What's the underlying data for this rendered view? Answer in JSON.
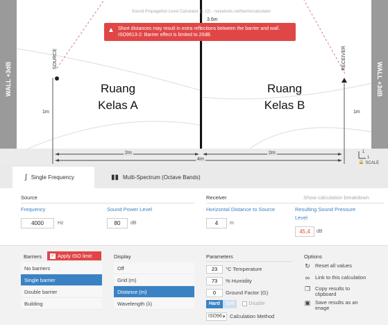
{
  "diagram": {
    "app_title": "Sound Propagation Level Calculator (1.12) - noisetools.net/barriercalculator",
    "warning_lines": [
      "Short distances may result in extra reflections between the barrier and wall.",
      "ISO9613-2: Barrier effect is limited to 20dB."
    ],
    "wall_left_label": "WALL +3dB",
    "wall_right_label": "WALL +3dB",
    "source_label": "SOURCE",
    "receiver_label": "RECEIVER",
    "barrier_height_label": "3.6m",
    "source_height_label": "1m",
    "receiver_height_label": "1m",
    "room_a_lines": [
      "Ruang",
      "Kelas A"
    ],
    "room_b_lines": [
      "Ruang",
      "Kelas B"
    ],
    "dist_left": "2m",
    "dist_right": "2m",
    "dist_total": "4m",
    "scale_top": "1",
    "scale_bottom": "1",
    "scale_label": "SCALE",
    "colors": {
      "wall": "#9a9a9a",
      "warning": "#e04646",
      "barrier": "#111111",
      "dashed_rays": "#e07a7a"
    }
  },
  "tabs": [
    {
      "label": "Single Frequency",
      "icon": "single-frequency-icon",
      "active": true
    },
    {
      "label": "Multi-Spectrum (Octave Bands)",
      "icon": "bar-chart-icon",
      "active": false
    }
  ],
  "source": {
    "title": "Source",
    "frequency_label": "Frequency",
    "frequency_value": "4000",
    "frequency_unit": "Hz",
    "power_label": "Sound Power Level",
    "power_value": "80",
    "power_unit": "dB"
  },
  "receiver": {
    "title": "Receiver",
    "breakdown_link": "Show calculation breakdown",
    "distance_label": "Horizontal Distance to Source",
    "distance_value": "4",
    "distance_unit": "m",
    "result_label_1": "Resulting Sound Pressure",
    "result_label_2": "Level",
    "result_value": "45,4",
    "result_unit": "dB"
  },
  "barriers": {
    "title": "Barriers",
    "iso_label": "Apply ISO limit",
    "items": [
      "No barriers",
      "Single barrier",
      "Double barrier",
      "Building"
    ],
    "selected": "Single barrier"
  },
  "display": {
    "title": "Display",
    "items": [
      "Off",
      "Grid (m)",
      "Distance (m)",
      "Wavelength (λ)"
    ],
    "selected": "Distance (m)"
  },
  "parameters": {
    "title": "Parameters",
    "temperature_value": "23",
    "temperature_label": "°C Temperature",
    "humidity_value": "73",
    "humidity_label": "% Humidity",
    "ground_value": "0",
    "ground_label": "Ground Factor (G)",
    "hard_label": "Hard",
    "soft_label": "Soft",
    "disable_label": "Disable",
    "method_value": "ISO96",
    "method_label": "Calculation Method"
  },
  "options": {
    "title": "Options",
    "items": [
      {
        "icon": "reset-icon",
        "lines": [
          "Reset all values"
        ]
      },
      {
        "icon": "link-icon",
        "lines": [
          "Link to this calculation"
        ]
      },
      {
        "icon": "copy-icon",
        "lines": [
          "Copy results to",
          "clipboard"
        ]
      },
      {
        "icon": "save-image-icon",
        "lines": [
          "Save results as an",
          "image"
        ]
      }
    ]
  }
}
